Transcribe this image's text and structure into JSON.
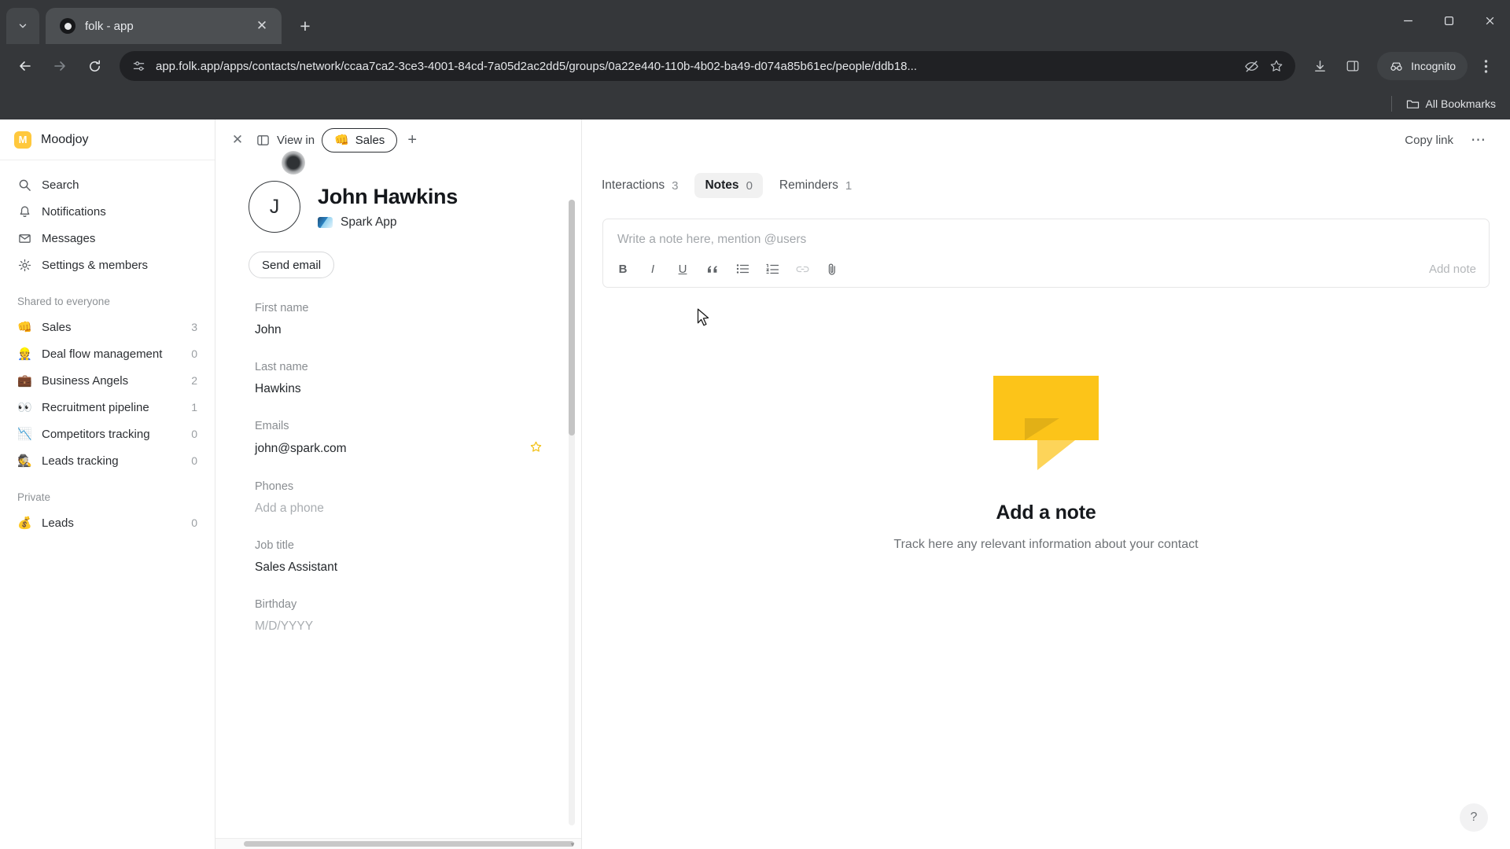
{
  "browser": {
    "tab": {
      "title": "folk - app",
      "favicon": "folk-circle-icon"
    },
    "new_tab_label": "+",
    "url": "app.folk.app/apps/contacts/network/ccaa7ca2-3ce3-4001-84cd-7a05d2ac2dd5/groups/0a22e440-110b-4b02-ba49-d074a85b61ec/people/ddb18...",
    "incognito_label": "Incognito",
    "bookmarks_label": "All Bookmarks",
    "window": {
      "minimize": "—",
      "maximize": "❐",
      "close": "✕"
    }
  },
  "sidebar": {
    "workspace": {
      "initial": "M",
      "name": "Moodjoy"
    },
    "nav": [
      {
        "icon": "search-icon",
        "label": "Search"
      },
      {
        "icon": "bell-icon",
        "label": "Notifications"
      },
      {
        "icon": "envelope-icon",
        "label": "Messages"
      },
      {
        "icon": "gear-icon",
        "label": "Settings & members"
      }
    ],
    "shared_title": "Shared to everyone",
    "shared_groups": [
      {
        "emoji": "👊",
        "label": "Sales",
        "count": "3"
      },
      {
        "emoji": "👷",
        "label": "Deal flow management",
        "count": "0"
      },
      {
        "emoji": "💼",
        "label": "Business Angels",
        "count": "2"
      },
      {
        "emoji": "👀",
        "label": "Recruitment pipeline",
        "count": "1"
      },
      {
        "emoji": "📉",
        "label": "Competitors tracking",
        "count": "0"
      },
      {
        "emoji": "🕵️",
        "label": "Leads tracking",
        "count": "0"
      }
    ],
    "private_title": "Private",
    "private_groups": [
      {
        "emoji": "💰",
        "label": "Leads",
        "count": "0"
      }
    ]
  },
  "contact_panel": {
    "topbar": {
      "close_label": "✕",
      "panel_icon": "side-panel-icon",
      "view_in_label": "View in",
      "group_pill": {
        "emoji": "👊",
        "label": "Sales"
      },
      "add_label": "+"
    },
    "avatar_initial": "J",
    "name": "John Hawkins",
    "company": "Spark App",
    "send_email_label": "Send email",
    "fields": [
      {
        "label": "First name",
        "value": "John",
        "placeholder": false,
        "starred": false
      },
      {
        "label": "Last name",
        "value": "Hawkins",
        "placeholder": false,
        "starred": false
      },
      {
        "label": "Emails",
        "value": "john@spark.com",
        "placeholder": false,
        "starred": true
      },
      {
        "label": "Phones",
        "value": "Add a phone",
        "placeholder": true,
        "starred": false
      },
      {
        "label": "Job title",
        "value": "Sales Assistant",
        "placeholder": false,
        "starred": false
      },
      {
        "label": "Birthday",
        "value": "M/D/YYYY",
        "placeholder": true,
        "starred": false
      }
    ]
  },
  "right_panel": {
    "copy_link_label": "Copy link",
    "more_label": "⋯",
    "tabs": [
      {
        "label": "Interactions",
        "count": "3",
        "active": false
      },
      {
        "label": "Notes",
        "count": "0",
        "active": true
      },
      {
        "label": "Reminders",
        "count": "1",
        "active": false
      }
    ],
    "note_placeholder": "Write a note here, mention @users",
    "add_note_label": "Add note",
    "toolbar": [
      {
        "name": "bold-icon",
        "glyph": "B"
      },
      {
        "name": "italic-icon",
        "glyph": "I"
      },
      {
        "name": "underline-icon",
        "glyph": "U"
      },
      {
        "name": "quote-icon",
        "glyph": "❝"
      },
      {
        "name": "bullet-list-icon",
        "glyph": "☰"
      },
      {
        "name": "numbered-list-icon",
        "glyph": "≡"
      },
      {
        "name": "link-icon",
        "glyph": "🔗"
      },
      {
        "name": "attachment-icon",
        "glyph": "📎"
      }
    ],
    "empty_state": {
      "title": "Add a note",
      "subtitle": "Track here any relevant information about your contact"
    },
    "help_label": "?"
  },
  "colors": {
    "accent_yellow": "#fcc419",
    "brand_yellow": "#ffc83d",
    "chrome_dark": "#35373a",
    "omnibox_dark": "#202124"
  }
}
